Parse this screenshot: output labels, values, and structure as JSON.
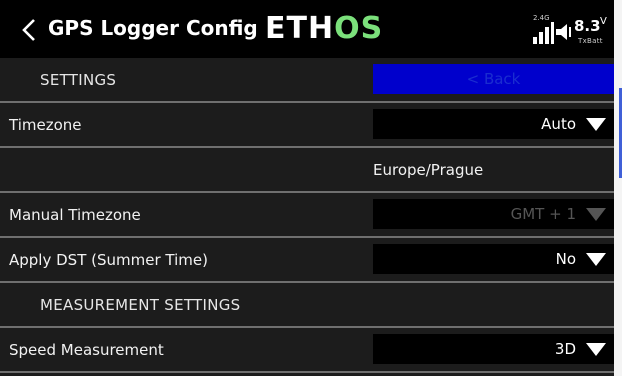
{
  "header": {
    "back_icon": "chevron-left-icon",
    "title": "GPS Logger Config",
    "logo": {
      "main": "ETH",
      "accent": "OS",
      "accent_color": "#7be07b"
    },
    "status": {
      "signal_label": "2.4G",
      "signal_icon": "signal-bars-icon",
      "speaker_icon": "speaker-icon",
      "battery_value": "8.3",
      "battery_unit": "V",
      "battery_caption": "TxBatt"
    }
  },
  "settings_section": {
    "title": "SETTINGS",
    "back_button": "< Back"
  },
  "timezone": {
    "label": "Timezone",
    "value": "Auto"
  },
  "timezone_detected": "Europe/Prague",
  "manual_timezone": {
    "label": "Manual Timezone",
    "value": "GMT + 1",
    "disabled": true
  },
  "apply_dst": {
    "label": "Apply DST (Summer Time)",
    "value": "No"
  },
  "measurement_section": {
    "title": "MEASUREMENT SETTINGS"
  },
  "speed_measurement": {
    "label": "Speed Measurement",
    "value": "3D"
  },
  "colors": {
    "background": "#1c1c1c",
    "header": "#000000",
    "accent_blue": "#0000cc",
    "separator": "#6f6f6f"
  }
}
